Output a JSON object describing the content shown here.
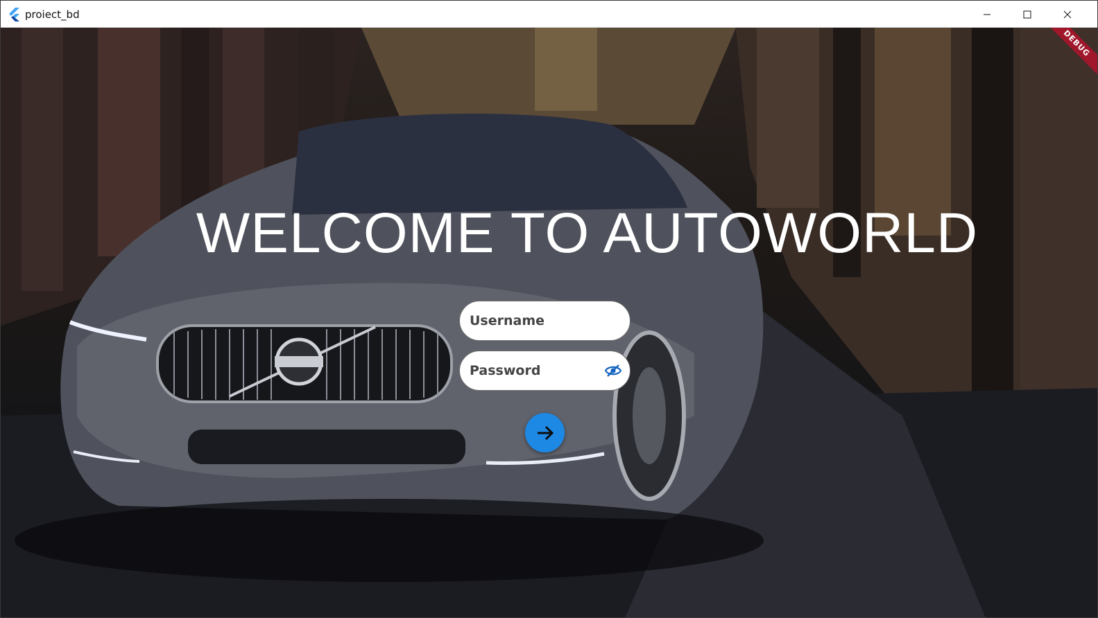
{
  "window": {
    "title": "proiect_bd",
    "icon": "flutter-icon",
    "controls": [
      "minimize-icon",
      "maximize-icon",
      "close-icon"
    ]
  },
  "banner": {
    "text": "DEBUG",
    "color": "#a0162b"
  },
  "main": {
    "headline": "WELCOME TO AUTOWORLD"
  },
  "form": {
    "username_placeholder": "Username",
    "password_placeholder": "Password",
    "password_toggle_icon": "eye-off-icon",
    "submit_icon": "arrow-right-icon",
    "accent": "#1e88e5"
  }
}
